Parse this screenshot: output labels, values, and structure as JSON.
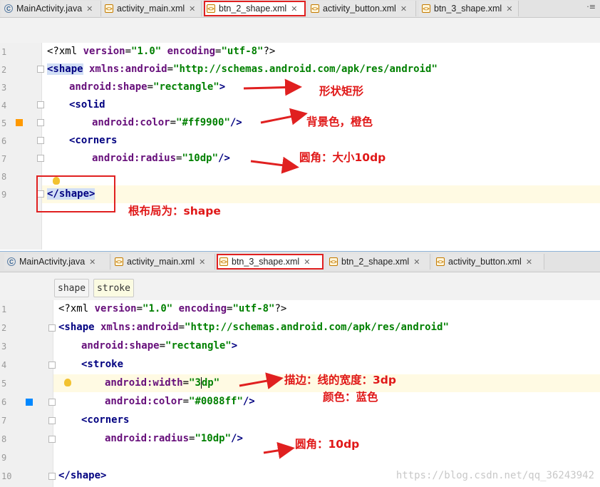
{
  "panel1": {
    "tabs": [
      {
        "label": "MainActivity.java",
        "icon": "class-icon"
      },
      {
        "label": "activity_main.xml",
        "icon": "xml-file-icon"
      },
      {
        "label": "btn_2_shape.xml",
        "icon": "xml-file-icon",
        "active": true
      },
      {
        "label": "activity_button.xml",
        "icon": "xml-file-icon"
      },
      {
        "label": "btn_3_shape.xml",
        "icon": "xml-file-icon"
      }
    ],
    "tab_menu": "·≡",
    "line_numbers": [
      "1",
      "2",
      "3",
      "4",
      "5",
      "6",
      "7",
      "8",
      "9"
    ],
    "code": {
      "l1": {
        "open": "<?xml ",
        "a1": "version",
        "eq1": "=",
        "v1": "\"1.0\"",
        "a2": " encoding",
        "eq2": "=",
        "v2": "\"utf-8\"",
        "close": "?>"
      },
      "l2": {
        "tag": "<shape",
        "attr": " xmlns:android",
        "eq": "=",
        "val": "\"http://schemas.android.com/apk/res/android\""
      },
      "l3": {
        "attr": "android:shape",
        "eq": "=",
        "val": "\"rectangle\"",
        "close": ">"
      },
      "l4": {
        "tag": "<solid"
      },
      "l5": {
        "attr": "android:color",
        "eq": "=",
        "val": "\"#ff9900\"",
        "close": "/>"
      },
      "l6": {
        "tag": "<corners"
      },
      "l7": {
        "attr": "android:radius",
        "eq": "=",
        "val": "\"10dp\"",
        "close": "/>"
      },
      "l9": {
        "tag": "</shape",
        "close": ">"
      }
    },
    "swatch_color": "#ff9900",
    "annotations": {
      "shape": "形状矩形",
      "bg": "背景色，橙色",
      "corner": "圆角：大小10dp",
      "root": "根布局为：shape"
    }
  },
  "panel2": {
    "tabs": [
      {
        "label": "MainActivity.java",
        "icon": "class-icon"
      },
      {
        "label": "activity_main.xml",
        "icon": "xml-file-icon"
      },
      {
        "label": "btn_3_shape.xml",
        "icon": "xml-file-icon",
        "active": true
      },
      {
        "label": "btn_2_shape.xml",
        "icon": "xml-file-icon"
      },
      {
        "label": "activity_button.xml",
        "icon": "xml-file-icon"
      }
    ],
    "breadcrumbs": [
      "shape",
      "stroke"
    ],
    "line_numbers": [
      "1",
      "2",
      "3",
      "4",
      "5",
      "6",
      "7",
      "8",
      "9",
      "10"
    ],
    "code": {
      "l1": {
        "open": "<?xml ",
        "a1": "version",
        "eq1": "=",
        "v1": "\"1.0\"",
        "a2": " encoding",
        "eq2": "=",
        "v2": "\"utf-8\"",
        "close": "?>"
      },
      "l2": {
        "tag": "<shape",
        "attr": " xmlns:android",
        "eq": "=",
        "val": "\"http://schemas.android.com/apk/res/android\""
      },
      "l3": {
        "attr": "android:shape",
        "eq": "=",
        "val": "\"rectangle\"",
        "close": ">"
      },
      "l4": {
        "tag": "<stroke"
      },
      "l5": {
        "attr": "android:width",
        "eq": "=",
        "val_a": "\"3",
        "val_b": "dp\""
      },
      "l6": {
        "attr": "android:color",
        "eq": "=",
        "val": "\"#0088ff\"",
        "close": "/>"
      },
      "l7": {
        "tag": "<corners"
      },
      "l8": {
        "attr": "android:radius",
        "eq": "=",
        "val": "\"10dp\"",
        "close": "/>"
      },
      "l10": {
        "tag": "</shape",
        "close": ">"
      }
    },
    "swatch_color": "#0088ff",
    "annotations": {
      "stroke": "描边：线的宽度：3dp",
      "color": "颜色：蓝色",
      "corner": "圆角：10dp"
    },
    "watermark": "https://blog.csdn.net/qq_36243942"
  }
}
